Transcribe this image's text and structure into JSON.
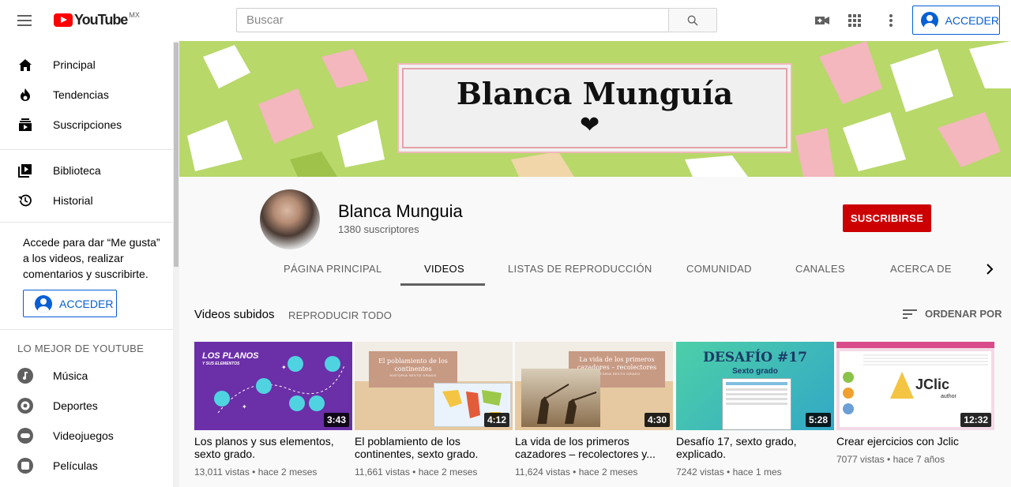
{
  "header": {
    "logo_text": "YouTube",
    "logo_region": "MX",
    "search_placeholder": "Buscar",
    "signin_label": "ACCEDER"
  },
  "sidebar": {
    "primary": [
      {
        "label": "Principal",
        "icon": "home-icon"
      },
      {
        "label": "Tendencias",
        "icon": "trending-icon"
      },
      {
        "label": "Suscripciones",
        "icon": "subscriptions-icon"
      }
    ],
    "library": [
      {
        "label": "Biblioteca",
        "icon": "library-icon"
      },
      {
        "label": "Historial",
        "icon": "history-icon"
      }
    ],
    "signin_prompt": "Accede para dar “Me gusta” a los videos, realizar comentarios y suscribirte.",
    "signin_label": "ACCEDER",
    "best_of_title": "LO MEJOR DE YOUTUBE",
    "best_of": [
      {
        "label": "Música",
        "icon": "music-icon"
      },
      {
        "label": "Deportes",
        "icon": "sports-icon"
      },
      {
        "label": "Videojuegos",
        "icon": "gaming-icon"
      },
      {
        "label": "Películas",
        "icon": "movies-icon"
      }
    ]
  },
  "banner": {
    "title": "Blanca Munguía",
    "heart": "❤",
    "background_color": "#b8d86a",
    "accent_color": "#f3b7bd"
  },
  "channel": {
    "name": "Blanca Munguia",
    "subscribers": "1380 suscriptores",
    "subscribe_label": "SUSCRIBIRSE",
    "tabs": [
      "PÁGINA PRINCIPAL",
      "VIDEOS",
      "LISTAS DE REPRODUCCIÓN",
      "COMUNIDAD",
      "CANALES",
      "ACERCA DE"
    ],
    "active_tab": "VIDEOS"
  },
  "videos_section": {
    "title": "Videos subidos",
    "play_all": "REPRODUCIR TODO",
    "sort_label": "ORDENAR POR"
  },
  "videos": [
    {
      "title": "Los planos y sus elementos, sexto grado.",
      "duration": "3:43",
      "views": "13,011 vistas",
      "age": "hace 2 meses",
      "thumb_text": "LOS PLANOS",
      "thumb_sub": "Y SUS ELEMENTOS"
    },
    {
      "title": "El poblamiento de los continentes, sexto grado.",
      "duration": "4:12",
      "views": "11,661 vistas",
      "age": "hace 2 meses",
      "thumb_text": "El poblamiento de los continentes",
      "thumb_sub": "HISTORIA SEXTO GRADO"
    },
    {
      "title": "La vida de los primeros cazadores – recolectores y...",
      "duration": "4:30",
      "views": "11,624 vistas",
      "age": "hace 2 meses",
      "thumb_text": "La vida de los primeros cazadores – recolectores",
      "thumb_sub": "HISTORIA SEXTO GRADO"
    },
    {
      "title": "Desafío 17, sexto grado, explicado.",
      "duration": "5:28",
      "views": "7242 vistas",
      "age": "hace 1 mes",
      "thumb_text": "DESAFÍO #17",
      "thumb_sub": "Sexto grado"
    },
    {
      "title": "Crear ejercicios con Jclic",
      "duration": "12:32",
      "views": "7077 vistas",
      "age": "hace 7 años",
      "thumb_text": "JClic",
      "thumb_sub": "author"
    }
  ],
  "colors": {
    "brand_red": "#ff0000",
    "subscribe_red": "#cc0000",
    "link_blue": "#065fd4"
  }
}
